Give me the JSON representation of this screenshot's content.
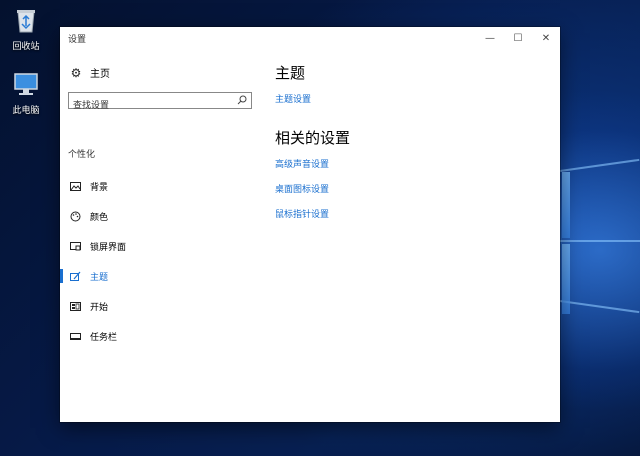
{
  "desktop": {
    "icons": [
      {
        "label": "回收站",
        "icon": "recycle-bin-icon"
      },
      {
        "label": "此电脑",
        "icon": "computer-icon"
      }
    ]
  },
  "window": {
    "title": "设置",
    "controls": {
      "minimize": "—",
      "maximize": "☐",
      "close": "✕"
    }
  },
  "sidebar": {
    "home_label": "主页",
    "search_placeholder": "查找设置",
    "section_label": "个性化",
    "items": [
      {
        "label": "背景",
        "icon": "picture-icon",
        "active": false
      },
      {
        "label": "颜色",
        "icon": "palette-icon",
        "active": false
      },
      {
        "label": "锁屏界面",
        "icon": "lock-screen-icon",
        "active": false
      },
      {
        "label": "主题",
        "icon": "theme-brush-icon",
        "active": true
      },
      {
        "label": "开始",
        "icon": "start-menu-icon",
        "active": false
      },
      {
        "label": "任务栏",
        "icon": "taskbar-icon",
        "active": false
      }
    ]
  },
  "main": {
    "heading": "主题",
    "theme_settings_link": "主题设置",
    "related_heading": "相关的设置",
    "related_links": [
      "高级声音设置",
      "桌面图标设置",
      "鼠标指针设置"
    ]
  },
  "colors": {
    "accent": "#1a6fcf",
    "desktop_bg": "#061a48"
  }
}
